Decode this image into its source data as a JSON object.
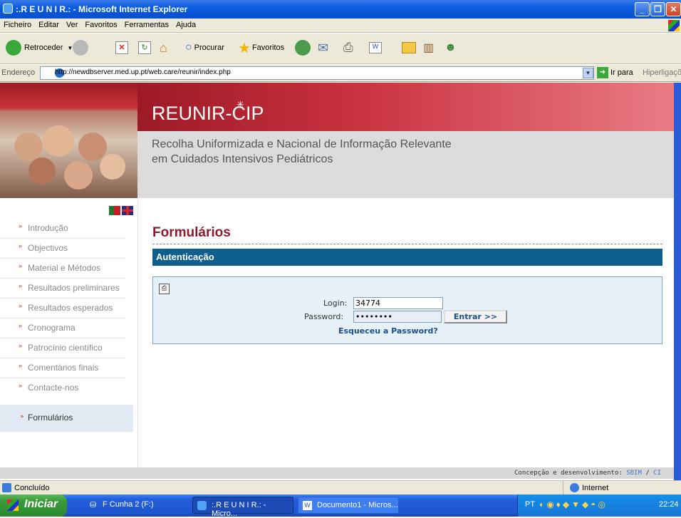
{
  "window": {
    "title": ":.R E U N I R.: - Microsoft Internet Explorer"
  },
  "menu": [
    "Ficheiro",
    "Editar",
    "Ver",
    "Favoritos",
    "Ferramentas",
    "Ajuda"
  ],
  "toolbar": {
    "back_label": "Retroceder",
    "search_label": "Procurar",
    "favorites_label": "Favoritos"
  },
  "address": {
    "label": "Endereço",
    "url": "http://newdbserver.med.up.pt/web.care/reunir/index.php",
    "go_label": "Ir para",
    "links_label": "Hiperligações"
  },
  "site": {
    "title": "REUNIR-CIP",
    "subtitle_line1": "Recolha Uniformizada e Nacional de Informação Relevante",
    "subtitle_line2": "em Cuidados Intensivos Pediátricos"
  },
  "nav": {
    "items": [
      {
        "label": "Introdução"
      },
      {
        "label": "Objectivos"
      },
      {
        "label": "Material e Métodos"
      },
      {
        "label": "Resultados preliminares"
      },
      {
        "label": "Resultados esperados"
      },
      {
        "label": "Cronograma"
      },
      {
        "label": "Patrocínio científico"
      },
      {
        "label": "Comentários finais"
      },
      {
        "label": "Contacte-nos"
      }
    ],
    "selected": "Formulários"
  },
  "content": {
    "heading": "Formulários",
    "section": "Autenticação",
    "login_label": "Login:",
    "login_value": "34774",
    "password_label": "Password:",
    "password_value": "••••••••",
    "submit_label": "Entrar >>",
    "forgot_label": "Esqueceu a Password?"
  },
  "footer": {
    "text": "Concepção e desenvolvimento:",
    "link1": "SBIM",
    "sep": "/",
    "link2": "CI"
  },
  "status": {
    "left": "Concluído",
    "zone": "Internet"
  },
  "taskbar": {
    "start": "Iniciar",
    "tasks": [
      ":.R E U N I R.: - Micro...",
      "Documento1 - Micros..."
    ],
    "drive": "F Cunha 2 (F:)",
    "lang": "PT",
    "time": "22:24"
  }
}
